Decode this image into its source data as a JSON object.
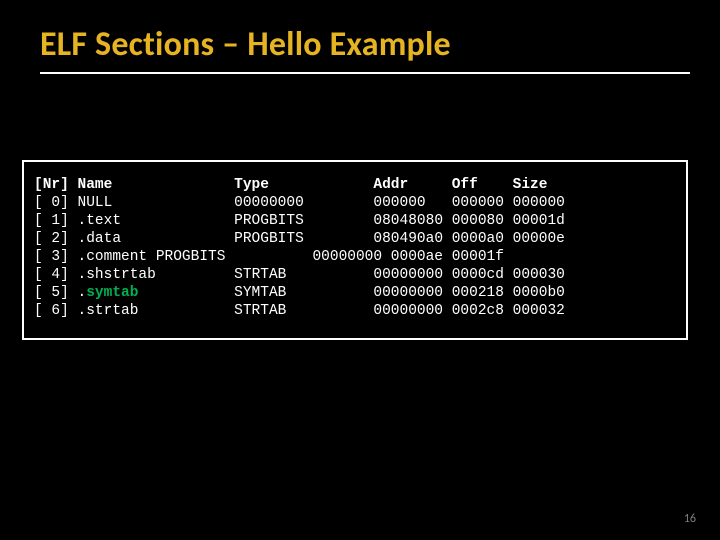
{
  "title": "ELF Sections – Hello Example",
  "page_number": "16",
  "table": {
    "header": {
      "nr": "[Nr]",
      "name": "Name",
      "type": "Type",
      "addr": "Addr",
      "off": "Off",
      "size": "Size"
    },
    "rows": [
      {
        "nr": "[ 0]",
        "name": "NULL",
        "type": "00000000",
        "addr": "000000",
        "off": "000000",
        "size": "000000"
      },
      {
        "nr": "[ 1]",
        "name": ".text",
        "type": "PROGBITS",
        "addr": "08048080",
        "off": "000080",
        "size": "00001d"
      },
      {
        "nr": "[ 2]",
        "name": ".data",
        "type": "PROGBITS",
        "addr": "080490a0",
        "off": "0000a0",
        "size": "00000e"
      },
      {
        "nr": "[ 3]",
        "name": ".comment PROGBITS",
        "type": "",
        "addr": "00000000",
        "off": "0000ae",
        "size": "00001f"
      },
      {
        "nr": "[ 4]",
        "name": ".shstrtab",
        "type": "STRTAB",
        "addr": "00000000",
        "off": "0000cd",
        "size": "000030"
      },
      {
        "nr": "[ 5]",
        "name": ".symtab",
        "type": "SYMTAB",
        "addr": "00000000",
        "off": "000218",
        "size": "0000b0",
        "highlight_name": true
      },
      {
        "nr": "[ 6]",
        "name": ".strtab",
        "type": "STRTAB",
        "addr": "00000000",
        "off": "0002c8",
        "size": "000032"
      }
    ]
  }
}
